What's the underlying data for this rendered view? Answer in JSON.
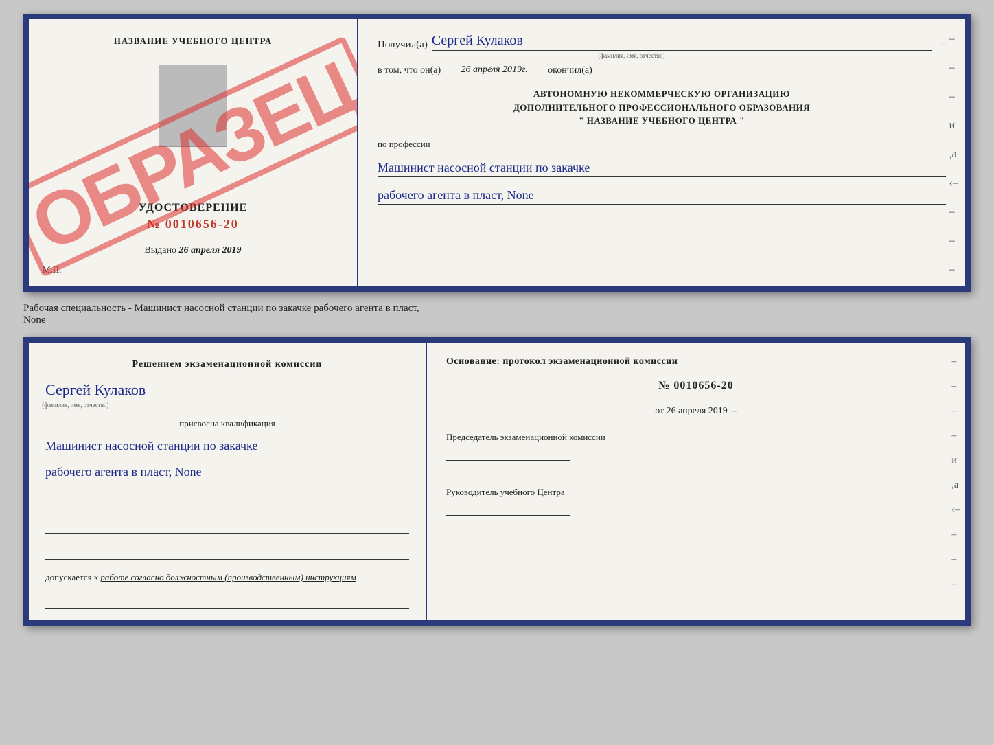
{
  "top_document": {
    "left": {
      "center_name": "НАЗВАНИЕ УЧЕБНОГО ЦЕНТРА",
      "obraz_text": "ОБРАЗЕЦ",
      "udostoverenie_title": "УДОСТОВЕРЕНИЕ",
      "udostoverenie_number": "№ 0010656-20",
      "vydano_label": "Выдано",
      "vydano_date": "26 апреля 2019",
      "mp_label": "М.П."
    },
    "right": {
      "poluchil_label": "Получил(а)",
      "poluchil_name": "Сергей Кулаков",
      "fio_hint": "(фамилия, имя, отчество)",
      "vtom_label": "в том, что он(а)",
      "vtom_date": "26 апреля 2019г.",
      "okonchil_label": "окончил(а)",
      "org_line1": "АВТОНОМНУЮ НЕКОММЕРЧЕСКУЮ ОРГАНИЗАЦИЮ",
      "org_line2": "ДОПОЛНИТЕЛЬНОГО ПРОФЕССИОНАЛЬНОГО ОБРАЗОВАНИЯ",
      "org_name": "\" НАЗВАНИЕ УЧЕБНОГО ЦЕНТРА \"",
      "po_professii": "по профессии",
      "profession_line1": "Машинист насосной станции по закачке",
      "profession_line2": "рабочего агента в пласт, None"
    }
  },
  "caption": {
    "text": "Рабочая специальность - Машинист насосной станции по закачке рабочего агента в пласт,",
    "text2": "None"
  },
  "bottom_document": {
    "left": {
      "resheniem_title": "Решением экзаменационной комиссии",
      "person_name": "Сергей Кулаков",
      "fio_hint": "(фамилия, имя, отчество)",
      "prisvoena": "присвоена квалификация",
      "qualification_line1": "Машинист насосной станции по закачке",
      "qualification_line2": "рабочего агента в пласт, None",
      "dopuskaetsya_label": "допускается к",
      "dopuskaetsya_value": "работе согласно должностным (производственным) инструкциям"
    },
    "right": {
      "osnovanie_label": "Основание: протокол экзаменационной комиссии",
      "protocol_number": "№ 0010656-20",
      "ot_label": "от",
      "ot_date": "26 апреля 2019",
      "predsedatel_title": "Председатель экзаменационной комиссии",
      "rukovoditel_title": "Руководитель учебного Центра"
    }
  }
}
